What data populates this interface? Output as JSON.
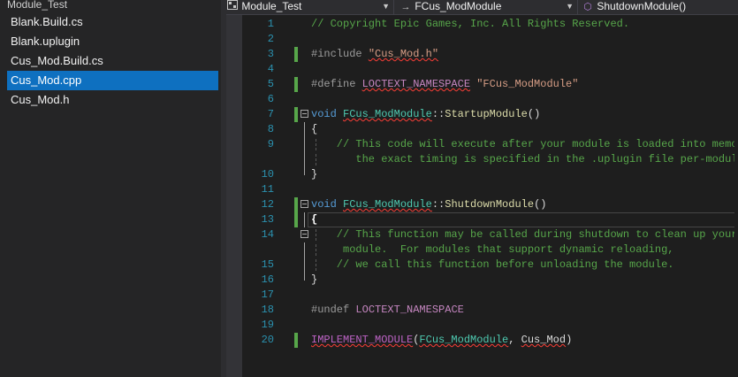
{
  "explorer": {
    "title": "Module_Test",
    "files": [
      {
        "label": "Blank.Build.cs",
        "selected": false
      },
      {
        "label": "Blank.uplugin",
        "selected": false
      },
      {
        "label": "Cus_Mod.Build.cs",
        "selected": false
      },
      {
        "label": "Cus_Mod.cpp",
        "selected": true
      },
      {
        "label": "Cus_Mod.h",
        "selected": false
      }
    ]
  },
  "navbar": {
    "project": "Module_Test",
    "scope": "FCus_ModModule",
    "member": "ShutdownModule()"
  },
  "editor": {
    "lines": [
      {
        "n": "1",
        "text": "// Copyright Epic Games, Inc. All Rights Reserved."
      },
      {
        "n": "2",
        "text": ""
      },
      {
        "n": "3",
        "text": "#include \"Cus_Mod.h\""
      },
      {
        "n": "4",
        "text": ""
      },
      {
        "n": "5",
        "text": "#define LOCTEXT_NAMESPACE \"FCus_ModModule\""
      },
      {
        "n": "6",
        "text": ""
      },
      {
        "n": "7",
        "text": "void FCus_ModModule::StartupModule()"
      },
      {
        "n": "8",
        "text": "{"
      },
      {
        "n": "9",
        "text": "    // This code will execute after your module is loaded into memory;"
      },
      {
        "n": "",
        "text": "       the exact timing is specified in the .uplugin file per-module"
      },
      {
        "n": "10",
        "text": "}"
      },
      {
        "n": "11",
        "text": ""
      },
      {
        "n": "12",
        "text": "void FCus_ModModule::ShutdownModule()"
      },
      {
        "n": "13",
        "text": "{"
      },
      {
        "n": "14",
        "text": "    // This function may be called during shutdown to clean up your"
      },
      {
        "n": "",
        "text": "     module.  For modules that support dynamic reloading,"
      },
      {
        "n": "15",
        "text": "    // we call this function before unloading the module."
      },
      {
        "n": "16",
        "text": "}"
      },
      {
        "n": "17",
        "text": ""
      },
      {
        "n": "18",
        "text": "#undef LOCTEXT_NAMESPACE"
      },
      {
        "n": "19",
        "text": ""
      },
      {
        "n": "20",
        "text": "IMPLEMENT_MODULE(FCus_ModModule, Cus_Mod)"
      }
    ]
  },
  "colors": {
    "background": "#1e1e1e",
    "selection": "#0e70c0",
    "line_number": "#2b91af",
    "comment": "#57a64a",
    "keyword": "#569cd6",
    "change_bar": "#57a64a"
  },
  "icons": {
    "project": "cpp-project-icon",
    "scope_arrow": "arrow-right-icon",
    "member": "method-cube-icon"
  }
}
